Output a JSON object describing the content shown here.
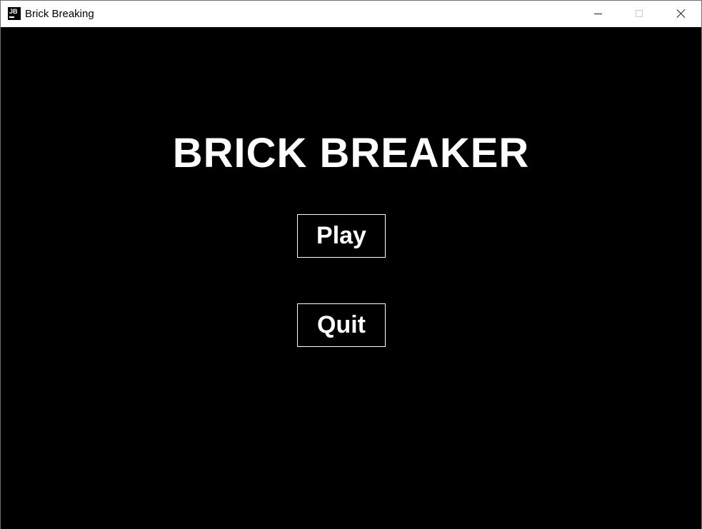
{
  "window": {
    "title": "Brick Breaking",
    "icon": "jetbrains-app-icon",
    "icon_text": "JB"
  },
  "titlebar_controls": {
    "minimize": "minimize-icon",
    "maximize": "maximize-icon",
    "close": "close-icon"
  },
  "game": {
    "title": "BRICK BREAKER",
    "background_color": "#000000",
    "text_color": "#ffffff",
    "menu": {
      "play_label": "Play",
      "quit_label": "Quit"
    }
  }
}
